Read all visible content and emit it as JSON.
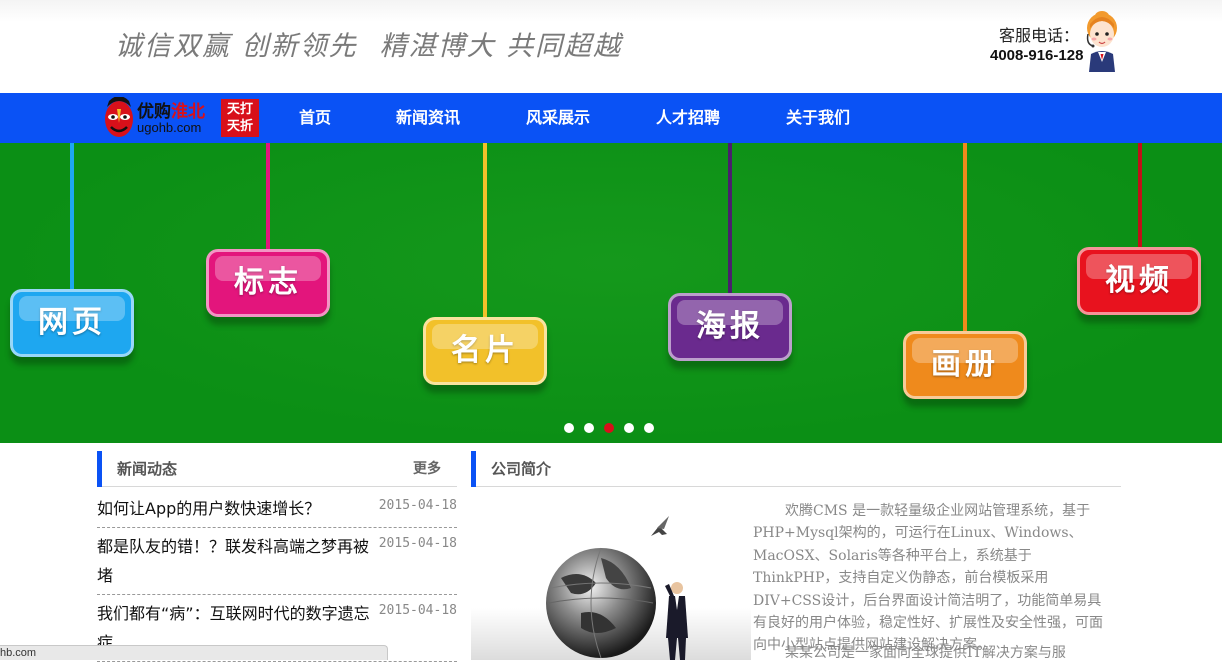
{
  "header": {
    "slogan_left": "诚信双赢 创新领先",
    "slogan_right": "精湛博大 共同超越",
    "hotline_label": "客服电话：",
    "hotline_number": "4008-916-128",
    "avatar_icon": "customer-service-girl-icon"
  },
  "logo": {
    "name_black": "优购",
    "name_red": "淮北",
    "url": "ugohb.com",
    "badge_line1": "天打",
    "badge_line2": "天折"
  },
  "nav": {
    "items": [
      {
        "label": "首页"
      },
      {
        "label": "新闻资讯"
      },
      {
        "label": "风采展示"
      },
      {
        "label": "人才招聘"
      },
      {
        "label": "关于我们"
      }
    ],
    "color": "#0a52f5"
  },
  "banner": {
    "background": "#0b8f15",
    "tags": [
      {
        "label": "网页",
        "color": "#1ea7f0"
      },
      {
        "label": "标志",
        "color": "#e3157c"
      },
      {
        "label": "名片",
        "color": "#f2c12a"
      },
      {
        "label": "海报",
        "color": "#6a2a8e"
      },
      {
        "label": "画册",
        "color": "#ef8a1c"
      },
      {
        "label": "视频",
        "color": "#e8121e"
      }
    ],
    "slide_count": 5,
    "active_slide": 3,
    "active_dot_color": "#d8101a"
  },
  "news": {
    "title": "新闻动态",
    "more_label": "更多",
    "items": [
      {
        "title": "如何让App的用户数快速增长？",
        "date": "2015-04-18"
      },
      {
        "title": "都是队友的错！？联发科高端之梦再被堵",
        "date": "2015-04-18"
      },
      {
        "title": "我们都有“病”：互联网时代的数字遗忘症",
        "date": "2015-04-18"
      }
    ]
  },
  "about": {
    "title": "公司简介",
    "paragraph1": "欢腾CMS 是一款轻量级企业网站管理系统，基于PHP+Mysql架构的，可运行在Linux、Windows、MacOSX、Solaris等各种平台上，系统基于ThinkPHP，支持自定义伪静态，前台模板采用DIV+CSS设计，后台界面设计简洁明了，功能简单易具有良好的用户体验，稳定性好、扩展性及安全性强，可面向中小型站点提供网站建设解决方案。",
    "paragraph2": "某某公司是一家面向全球提供IT解决方案与服"
  },
  "statusbar": {
    "text": "hb.com"
  }
}
